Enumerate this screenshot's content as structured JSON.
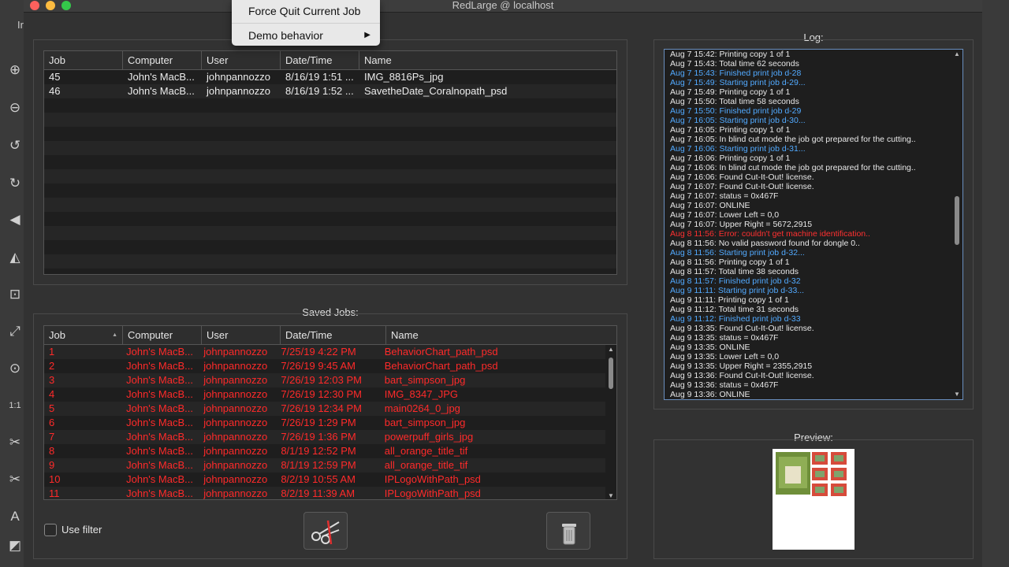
{
  "window": {
    "title": "RedLarge @ localhost"
  },
  "background_app": {
    "partial_text": "Ir"
  },
  "menu": {
    "items": [
      {
        "label": "Force Quit Current Job"
      },
      {
        "label": "Demo behavior",
        "submenu_arrow": "▶"
      }
    ]
  },
  "queue_table": {
    "columns": [
      "Job",
      "Computer",
      "User",
      "Date/Time",
      "Name"
    ],
    "rows": [
      {
        "job": "45",
        "computer": "John's MacB...",
        "user": "johnpannozzo",
        "datetime": "8/16/19 1:51 ...",
        "name": "IMG_8816Ps_jpg"
      },
      {
        "job": "46",
        "computer": "John's MacB...",
        "user": "johnpannozzo",
        "datetime": "8/16/19 1:52 ...",
        "name": "SavetheDate_Coralnopath_psd"
      }
    ]
  },
  "saved_jobs": {
    "label": "Saved Jobs:",
    "sort_indicator": "▲",
    "columns": [
      "Job",
      "Computer",
      "User",
      "Date/Time",
      "Name"
    ],
    "rows": [
      {
        "job": "1",
        "computer": "John's MacB...",
        "user": "johnpannozzo",
        "datetime": "7/25/19 4:22 PM",
        "name": "BehaviorChart_path_psd"
      },
      {
        "job": "2",
        "computer": "John's MacB...",
        "user": "johnpannozzo",
        "datetime": "7/26/19 9:45 AM",
        "name": "BehaviorChart_path_psd"
      },
      {
        "job": "3",
        "computer": "John's MacB...",
        "user": "johnpannozzo",
        "datetime": "7/26/19 12:03 PM",
        "name": "bart_simpson_jpg"
      },
      {
        "job": "4",
        "computer": "John's MacB...",
        "user": "johnpannozzo",
        "datetime": "7/26/19 12:30 PM",
        "name": "IMG_8347_JPG"
      },
      {
        "job": "5",
        "computer": "John's MacB...",
        "user": "johnpannozzo",
        "datetime": "7/26/19 12:34 PM",
        "name": "main0264_0_jpg"
      },
      {
        "job": "6",
        "computer": "John's MacB...",
        "user": "johnpannozzo",
        "datetime": "7/26/19 1:29 PM",
        "name": "bart_simpson_jpg"
      },
      {
        "job": "7",
        "computer": "John's MacB...",
        "user": "johnpannozzo",
        "datetime": "7/26/19 1:36 PM",
        "name": "powerpuff_girls_jpg"
      },
      {
        "job": "8",
        "computer": "John's MacB...",
        "user": "johnpannozzo",
        "datetime": "8/1/19 12:52 PM",
        "name": "all_orange_title_tif"
      },
      {
        "job": "9",
        "computer": "John's MacB...",
        "user": "johnpannozzo",
        "datetime": "8/1/19 12:59 PM",
        "name": "all_orange_title_tif"
      },
      {
        "job": "10",
        "computer": "John's MacB...",
        "user": "johnpannozzo",
        "datetime": "8/2/19 10:55 AM",
        "name": "IPLogoWithPath_psd"
      },
      {
        "job": "11",
        "computer": "John's MacB...",
        "user": "johnpannozzo",
        "datetime": "8/2/19 11:39 AM",
        "name": "IPLogoWithPath_psd"
      }
    ],
    "use_filter_label": "Use filter"
  },
  "log": {
    "label": "Log:",
    "lines": [
      {
        "text": "Aug  7 15:42: Printing copy 1 of 1",
        "kind": "normal"
      },
      {
        "text": "Aug  7 15:43: Total time 62 seconds",
        "kind": "normal"
      },
      {
        "text": "Aug  7 15:43: Finished print job d-28",
        "kind": "blue"
      },
      {
        "text": "Aug  7 15:49: Starting print job d-29...",
        "kind": "blue"
      },
      {
        "text": "Aug  7 15:49: Printing copy 1 of 1",
        "kind": "normal"
      },
      {
        "text": "Aug  7 15:50: Total time 58 seconds",
        "kind": "normal"
      },
      {
        "text": "Aug  7 15:50: Finished print job d-29",
        "kind": "blue"
      },
      {
        "text": "Aug  7 16:05: Starting print job d-30...",
        "kind": "blue"
      },
      {
        "text": "Aug  7 16:05: Printing copy 1 of 1",
        "kind": "normal"
      },
      {
        "text": "Aug  7 16:05: In blind cut mode the job got prepared for the cutting..",
        "kind": "normal"
      },
      {
        "text": "Aug  7 16:06: Starting print job d-31...",
        "kind": "blue"
      },
      {
        "text": "Aug  7 16:06: Printing copy 1 of 1",
        "kind": "normal"
      },
      {
        "text": "Aug  7 16:06: In blind cut mode the job got prepared for the cutting..",
        "kind": "normal"
      },
      {
        "text": "Aug  7 16:06: Found Cut-It-Out! license.",
        "kind": "normal"
      },
      {
        "text": "Aug  7 16:07: Found Cut-It-Out! license.",
        "kind": "normal"
      },
      {
        "text": "Aug  7 16:07: status = 0x467F",
        "kind": "normal"
      },
      {
        "text": "Aug  7 16:07: ONLINE",
        "kind": "normal"
      },
      {
        "text": "Aug  7 16:07: Lower Left = 0,0",
        "kind": "normal"
      },
      {
        "text": "Aug  7 16:07: Upper Right = 5672,2915",
        "kind": "normal"
      },
      {
        "text": "Aug  8 11:56: Error: couldn't get machine identification..",
        "kind": "red"
      },
      {
        "text": "Aug  8 11:56: No valid password found for dongle 0..",
        "kind": "normal"
      },
      {
        "text": "Aug  8 11:56: Starting print job d-32...",
        "kind": "blue"
      },
      {
        "text": "Aug  8 11:56: Printing copy 1 of 1",
        "kind": "normal"
      },
      {
        "text": "Aug  8 11:57: Total time 38 seconds",
        "kind": "normal"
      },
      {
        "text": "Aug  8 11:57: Finished print job d-32",
        "kind": "blue"
      },
      {
        "text": "Aug  9 11:11: Starting print job d-33...",
        "kind": "blue"
      },
      {
        "text": "Aug  9 11:11: Printing copy 1 of 1",
        "kind": "normal"
      },
      {
        "text": "Aug  9 11:12: Total time 31 seconds",
        "kind": "normal"
      },
      {
        "text": "Aug  9 11:12: Finished print job d-33",
        "kind": "blue"
      },
      {
        "text": "Aug  9 13:35: Found Cut-It-Out! license.",
        "kind": "normal"
      },
      {
        "text": "Aug  9 13:35: status = 0x467F",
        "kind": "normal"
      },
      {
        "text": "Aug  9 13:35: ONLINE",
        "kind": "normal"
      },
      {
        "text": "Aug  9 13:35: Lower Left = 0,0",
        "kind": "normal"
      },
      {
        "text": "Aug  9 13:35: Upper Right = 2355,2915",
        "kind": "normal"
      },
      {
        "text": "Aug  9 13:36: Found Cut-It-Out! license.",
        "kind": "normal"
      },
      {
        "text": "Aug  9 13:36: status = 0x467F",
        "kind": "normal"
      },
      {
        "text": "Aug  9 13:36: ONLINE",
        "kind": "normal"
      }
    ]
  },
  "preview": {
    "label": "Preview:"
  },
  "colors": {
    "error_red": "#ff2a2a",
    "log_blue": "#52aaff",
    "log_red": "#ff3030"
  },
  "icons": {
    "toolbar": [
      "zoom-in-icon",
      "zoom-out-icon",
      "rotate-left-icon",
      "rotate-right-icon",
      "flip-horizontal-icon",
      "mirror-icon",
      "fit-selection-icon",
      "expand-icon",
      "target-icon",
      "actual-size-icon",
      "cut-icon",
      "cut-selected-icon",
      "text-icon",
      "layers-icon"
    ],
    "cut_button": "scissors-icon",
    "delete_button": "trash-icon"
  }
}
